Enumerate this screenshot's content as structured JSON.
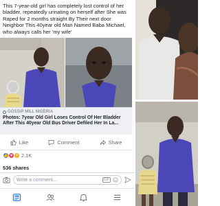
{
  "post": {
    "text": "This 7-year-old girl has completely lost control of her bladder, repeatedly urinating on herself after She was Raped for 2 months straight By Their next door Neighbor This 40year old Man Named Baba Michael, who always calls her 'my wife'"
  },
  "link_preview": {
    "source": "GOSSIP MILL NIGERIA",
    "title": "Photos: 7year Old Girl Loses Control Of Her Bladder After This 40year Old Bus Driver Defiled Her In La..."
  },
  "actions": {
    "like": "Like",
    "comment": "Comment",
    "share": "Share"
  },
  "reactions": {
    "count": "2.1K"
  },
  "shares": "536 shares",
  "comment_bar": {
    "placeholder": "Write a comment...",
    "gif_label": "GIF"
  },
  "colors": {
    "facebook_blue": "#1877f2",
    "shirt_purple": "#4b47b8",
    "secondary_text": "#606770"
  }
}
